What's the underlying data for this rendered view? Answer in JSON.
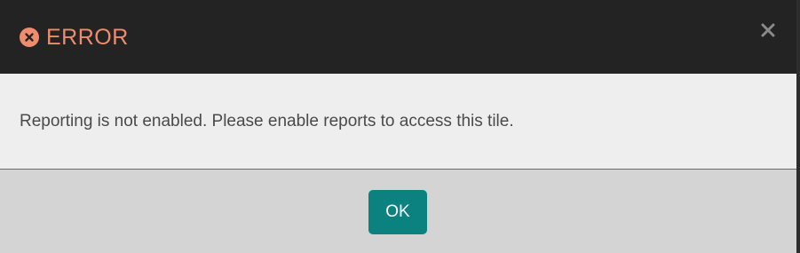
{
  "dialog": {
    "title": "ERROR",
    "title_icon": "error-circle-x-icon",
    "close_icon": "close-icon",
    "message": "Reporting is not enabled. Please enable reports to access this tile.",
    "ok_label": "OK"
  },
  "colors": {
    "header_bg": "#232323",
    "title_accent": "#f08c6e",
    "body_bg": "#eeeeee",
    "footer_bg": "#d4d4d4",
    "button_bg": "#0b8180",
    "button_text": "#ffffff",
    "message_text": "#4a4a4a",
    "close_icon": "#8a8a8a"
  }
}
